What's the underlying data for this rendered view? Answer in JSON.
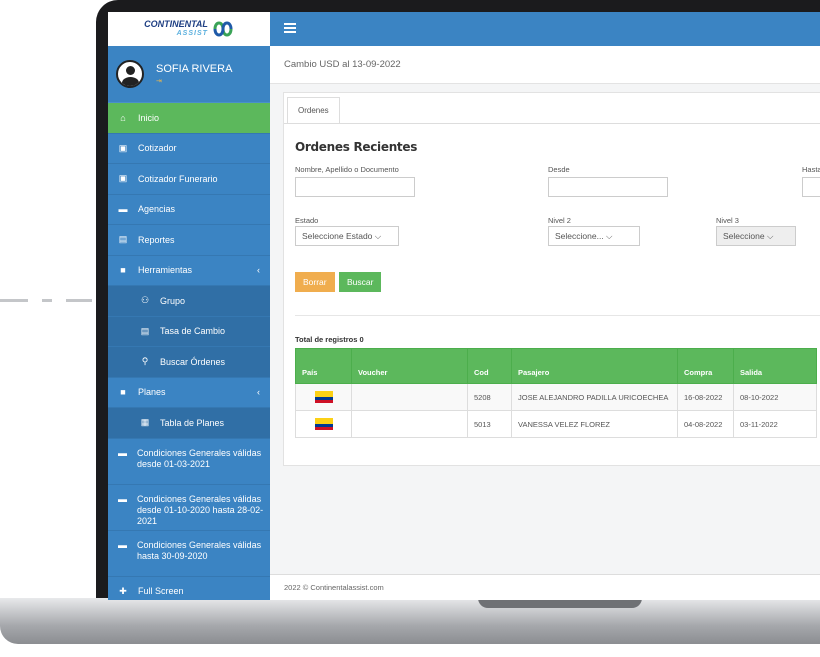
{
  "brand": {
    "name_top": "CONTINENTAL",
    "name_bottom": "ASSIST"
  },
  "user": {
    "name": "SOFIA RIVERA",
    "logout_icon": "sign-out-icon"
  },
  "sidebar": {
    "items": [
      {
        "label": "Inicio",
        "icon": "home-icon",
        "active": true
      },
      {
        "label": "Cotizador",
        "icon": "money-icon"
      },
      {
        "label": "Cotizador Funerario",
        "icon": "money-icon"
      },
      {
        "label": "Agencias",
        "icon": "briefcase-icon"
      },
      {
        "label": "Reportes",
        "icon": "chart-icon"
      },
      {
        "label": "Herramientas",
        "icon": "tools-icon",
        "caret": "‹"
      },
      {
        "label": "Grupo",
        "icon": "users-icon",
        "sub": true
      },
      {
        "label": "Tasa de Cambio",
        "icon": "chart-icon",
        "sub": true
      },
      {
        "label": "Buscar Órdenes",
        "icon": "search-icon",
        "sub": true
      },
      {
        "label": "Planes",
        "icon": "tools-icon",
        "caret": "‹"
      },
      {
        "label": "Tabla de Planes",
        "icon": "table-icon",
        "sub": true
      },
      {
        "label": "Condiciones Generales válidas desde 01-03-2021",
        "icon": "briefcase-icon"
      },
      {
        "label": "Condiciones Generales válidas desde 01-10-2020 hasta 28-02-2021",
        "icon": "briefcase-icon"
      },
      {
        "label": "Condiciones Generales válidas hasta 30-09-2020",
        "icon": "briefcase-icon"
      },
      {
        "label": "Full Screen",
        "icon": "arrows-icon"
      }
    ]
  },
  "header": {
    "exchange_text": "Cambio USD al 13-09-2022"
  },
  "tabs": [
    {
      "label": "Ordenes"
    }
  ],
  "orders": {
    "title": "Ordenes Recientes",
    "fields": {
      "name_label": "Nombre, Apellido o Documento",
      "from_label": "Desde",
      "to_label": "Hasta",
      "state_label": "Estado",
      "state_value": "Seleccione Estado",
      "level2_label": "Nivel 2",
      "level2_value": "Seleccione...",
      "level3_label": "Nivel 3",
      "level3_value": "Seleccione"
    },
    "buttons": {
      "clear": "Borrar",
      "search": "Buscar"
    },
    "total_label": "Total de registros 0",
    "columns": [
      "País",
      "Voucher",
      "Cod",
      "Pasajero",
      "Compra",
      "Salida"
    ],
    "rows": [
      {
        "country": "Colombia",
        "voucher": "",
        "cod": "5208",
        "passenger": "JOSE ALEJANDRO PADILLA URICOECHEA",
        "purchase": "16-08-2022",
        "departure": "08-10-2022"
      },
      {
        "country": "Colombia",
        "voucher": "",
        "cod": "5013",
        "passenger": "VANESSA VELEZ FLOREZ",
        "purchase": "04-08-2022",
        "departure": "03-11-2022"
      }
    ]
  },
  "footer": {
    "text": "2022 © Continentalassist.com"
  },
  "colors": {
    "sidebar": "#3b84c3",
    "active": "#5cb85c",
    "orange": "#f0ad4e",
    "flag_yellow": "#fcd116",
    "flag_blue": "#003893",
    "flag_red": "#ce1126"
  }
}
